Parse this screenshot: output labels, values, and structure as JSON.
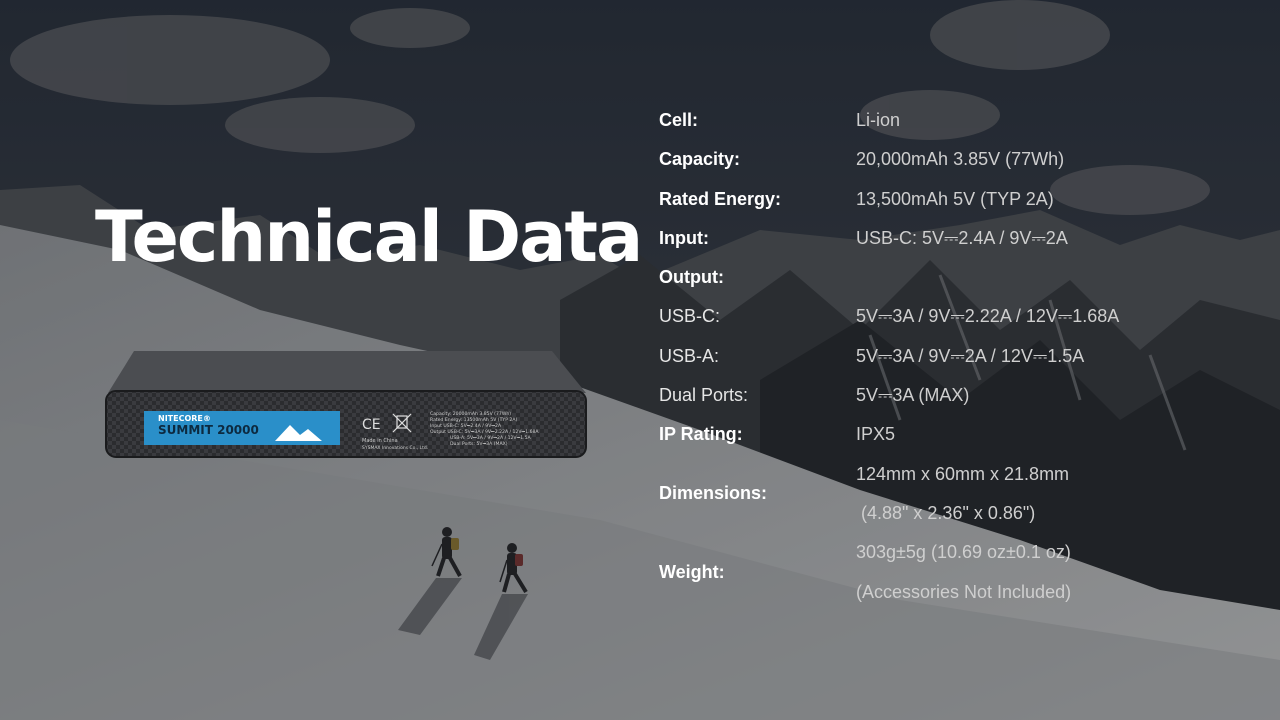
{
  "page": {
    "title": "Technical Data"
  },
  "colors": {
    "sky": "#3b4452",
    "snow": "#b9bcbf",
    "label_blue": "#2a8fc9",
    "text": "#ffffff",
    "value_text": "#cfcfcf"
  },
  "product": {
    "brand": "NITECORE®",
    "model": "SUMMIT 20000",
    "cert": "CE",
    "made_in": "Made in China",
    "maker": "SYSMAX Innovations Co., Ltd.",
    "label_lines": [
      "Capacity: 20000mAh 3.85V (77Wh)",
      "Rated Energy: 13500mAh 5V (TYP 2A)",
      "Input USB-C: 5V⎓2.4A / 9V⎓2A",
      "Output USB-C: 5V⎓3A / 9V⎓2.22A / 12V⎓1.68A",
      "USB-A: 5V⎓3A / 9V⎓2A / 12V⎓1.5A",
      "Dual Ports: 5V⎓3A (MAX)"
    ]
  },
  "specs": {
    "cell": {
      "label": "Cell:",
      "value": "Li-ion"
    },
    "capacity": {
      "label": "Capacity:",
      "value": "20,000mAh 3.85V (77Wh)"
    },
    "rated_energy": {
      "label": "Rated Energy:",
      "value": "13,500mAh 5V (TYP 2A)"
    },
    "input": {
      "label": "Input:",
      "value": "USB-C: 5V⎓2.4A / 9V⎓2A"
    },
    "output": {
      "label": "Output:",
      "value": ""
    },
    "usb_c": {
      "label": "USB-C:",
      "value": "5V⎓3A / 9V⎓2.22A / 12V⎓1.68A"
    },
    "usb_a": {
      "label": "USB-A:",
      "value": "5V⎓3A / 9V⎓2A / 12V⎓1.5A"
    },
    "dual_ports": {
      "label": "Dual Ports:",
      "value": "5V⎓3A (MAX)"
    },
    "ip_rating": {
      "label": "IP Rating:",
      "value": "IPX5"
    },
    "dimensions": {
      "label": "Dimensions:",
      "value_line1": "124mm x 60mm x 21.8mm",
      "value_line2": " (4.88\" x 2.36\" x 0.86\")"
    },
    "weight": {
      "label": "Weight:",
      "value_line1": "303g±5g (10.69 oz±0.1 oz)",
      "value_line2": "(Accessories Not Included)"
    }
  }
}
